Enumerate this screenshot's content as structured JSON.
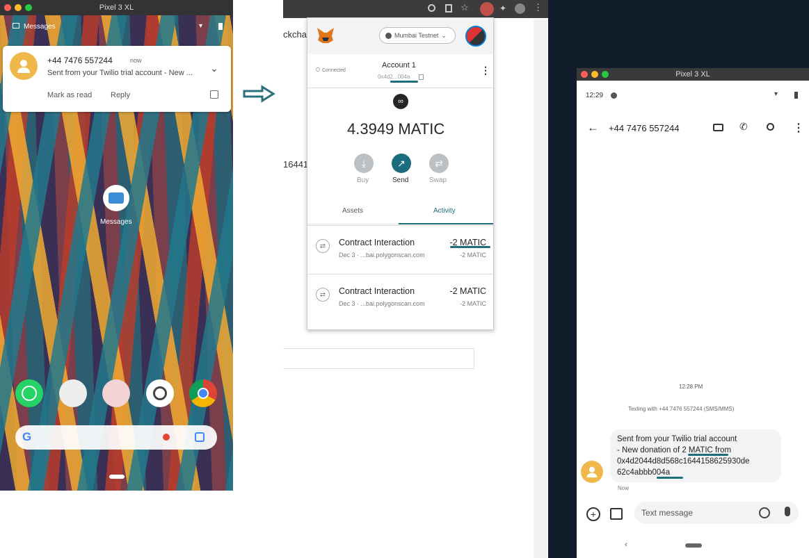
{
  "left_window": {
    "title": "Pixel 3 XL"
  },
  "left_phone": {
    "status_app": "Messages",
    "notification": {
      "sender": "+44 7476 557244",
      "time": "now",
      "body": "Sent from your Twilio trial account - New ...",
      "action_mark_read": "Mark as read",
      "action_reply": "Reply"
    },
    "home_icon_label": "Messages"
  },
  "browser": {
    "partial_text_1": "ckchai",
    "partial_text_2": "16441"
  },
  "metamask": {
    "network": "Mumbai Testnet",
    "account_name": "Account 1",
    "connected": "Connected",
    "address_short": "0x4d2...004a",
    "balance": "4.3949 MATIC",
    "buy": "Buy",
    "send": "Send",
    "swap": "Swap",
    "tab_assets": "Assets",
    "tab_activity": "Activity",
    "activity": [
      {
        "title": "Contract Interaction",
        "sub": "Dec 3 · ...bai.polygonscan.com",
        "amount": "-2 MATIC",
        "amount2": "-2 MATIC"
      },
      {
        "title": "Contract Interaction",
        "sub": "Dec 3 · ...bai.polygonscan.com",
        "amount": "-2 MATIC",
        "amount2": "-2 MATIC"
      }
    ]
  },
  "right_window": {
    "title": "Pixel 3 XL"
  },
  "right_phone": {
    "time": "12:29",
    "contact": "+44 7476 557244",
    "msg_time": "12:28 PM",
    "texting_with": "Texting with +44 7476 557244 (SMS/MMS)",
    "message_line1": "Sent from your Twilio trial account",
    "message_line2": "- New donation of 2 MATIC from",
    "message_line3": "0x4d2044d8d568c1644158625930de",
    "message_line4": "62c4abbb004a",
    "message_status": "Now",
    "compose_placeholder": "Text message"
  }
}
